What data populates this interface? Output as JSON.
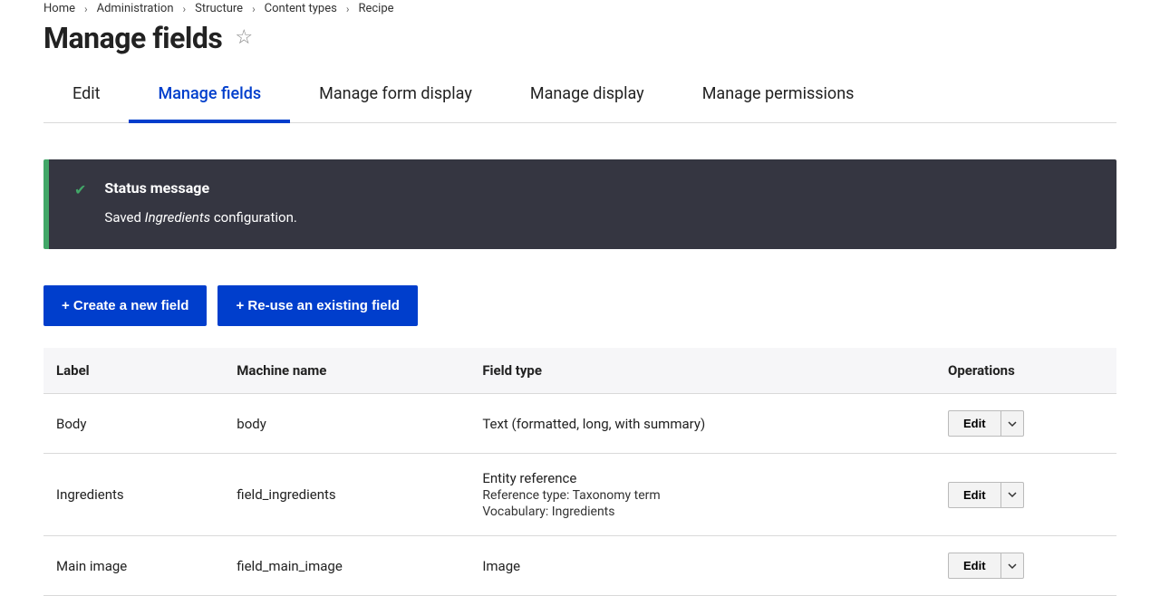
{
  "breadcrumb": [
    "Home",
    "Administration",
    "Structure",
    "Content types",
    "Recipe"
  ],
  "page_title": "Manage fields",
  "tabs": [
    {
      "label": "Edit",
      "active": false
    },
    {
      "label": "Manage fields",
      "active": true
    },
    {
      "label": "Manage form display",
      "active": false
    },
    {
      "label": "Manage display",
      "active": false
    },
    {
      "label": "Manage permissions",
      "active": false
    }
  ],
  "status": {
    "heading": "Status message",
    "prefix": "Saved ",
    "em": "Ingredients",
    "suffix": " configuration."
  },
  "actions": {
    "create": "+ Create a new field",
    "reuse": "+ Re-use an existing field"
  },
  "table": {
    "headers": {
      "label": "Label",
      "machine": "Machine name",
      "type": "Field type",
      "ops": "Operations"
    },
    "rows": [
      {
        "label": "Body",
        "machine": "body",
        "type": "Text (formatted, long, with summary)",
        "sub": []
      },
      {
        "label": "Ingredients",
        "machine": "field_ingredients",
        "type": "Entity reference",
        "sub": [
          "Reference type: Taxonomy term",
          "Vocabulary: Ingredients"
        ]
      },
      {
        "label": "Main image",
        "machine": "field_main_image",
        "type": "Image",
        "sub": []
      }
    ],
    "edit_label": "Edit"
  }
}
